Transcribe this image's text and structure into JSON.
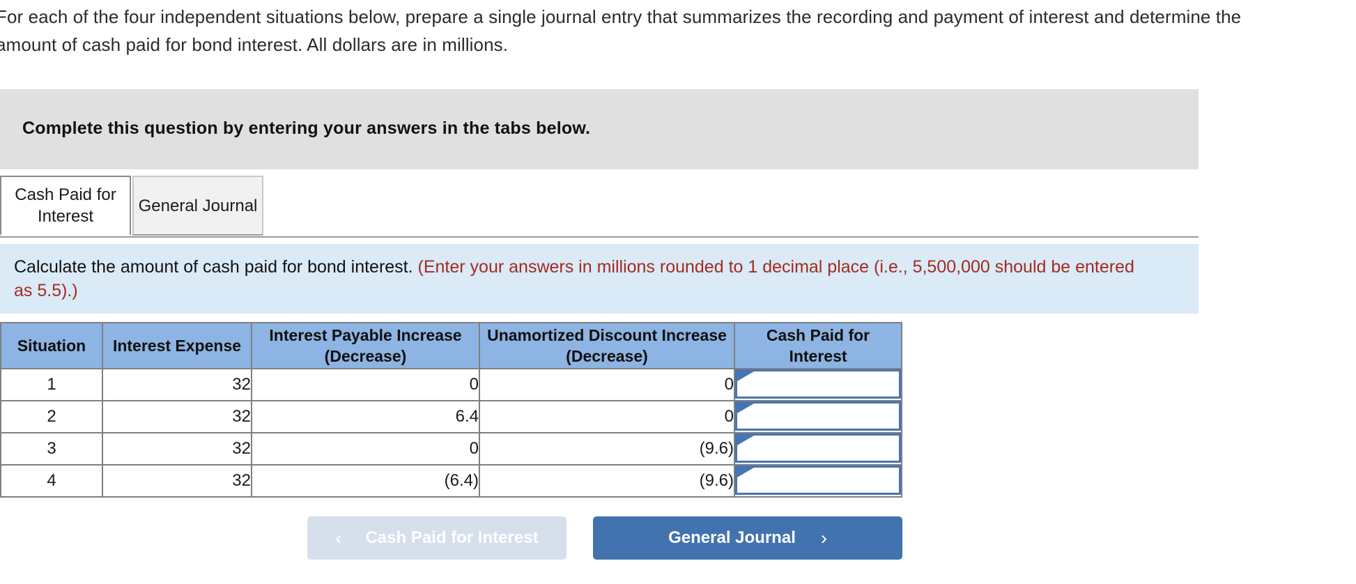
{
  "intro": {
    "text": "For each of the four independent situations below, prepare a single journal entry that summarizes the recording and payment of interest and determine the amount of cash paid for bond interest. All dollars are in millions."
  },
  "gray_banner": {
    "text": "Complete this question by entering your answers in the tabs below."
  },
  "tabs": [
    {
      "label": "Cash Paid for Interest",
      "active": true
    },
    {
      "label": "General Journal",
      "active": false
    }
  ],
  "instruction": {
    "black_text": "Calculate the amount of cash paid for bond interest.",
    "red_text": "(Enter your answers in millions rounded to 1 decimal place (i.e., 5,500,000 should be entered as 5.5).)"
  },
  "table": {
    "headers": [
      "Situation",
      "Interest Expense",
      "Interest Payable Increase (Decrease)",
      "Unamortized Discount Increase (Decrease)",
      "Cash Paid for Interest"
    ],
    "rows": [
      {
        "situation": "1",
        "interest_expense": "32",
        "interest_payable": "0",
        "unamortized_discount": "0",
        "cash_paid": ""
      },
      {
        "situation": "2",
        "interest_expense": "32",
        "interest_payable": "6.4",
        "unamortized_discount": "0",
        "cash_paid": ""
      },
      {
        "situation": "3",
        "interest_expense": "32",
        "interest_payable": "0",
        "unamortized_discount": "(9.6)",
        "cash_paid": ""
      },
      {
        "situation": "4",
        "interest_expense": "32",
        "interest_payable": "(6.4)",
        "unamortized_discount": "(9.6)",
        "cash_paid": ""
      }
    ]
  },
  "buttons": {
    "prev": {
      "label": "Cash Paid for Interest",
      "chevron": "‹"
    },
    "next": {
      "label": "General Journal",
      "chevron": "›"
    }
  },
  "colors": {
    "table_header_blue": "#8db4e2",
    "instruction_banner_blue": "#daeaf7",
    "gray_banner": "#e0e0e0",
    "red_note": "#a52a1e",
    "input_border_blue": "#4674b5",
    "next_button_blue": "#4273ae",
    "prev_button_blue": "#d5e0ec"
  }
}
